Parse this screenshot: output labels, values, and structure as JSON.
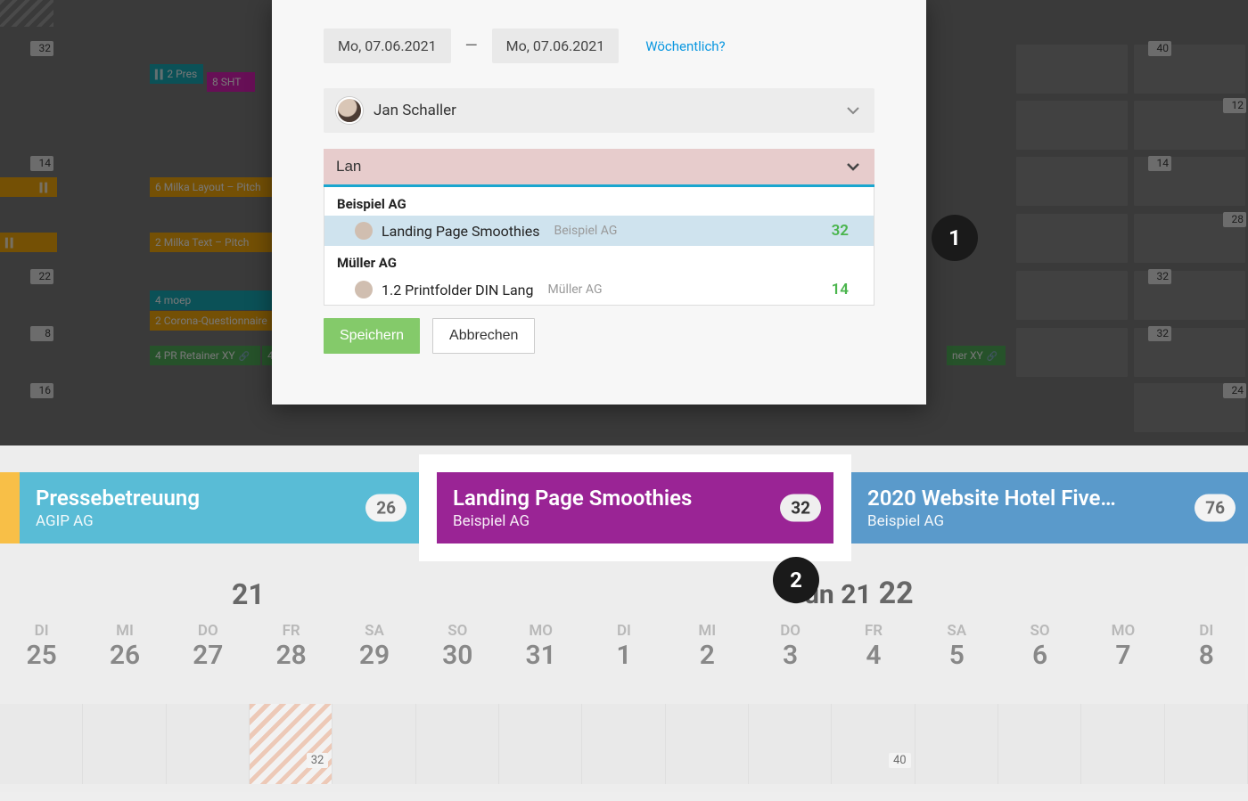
{
  "top_bg": {
    "left_badges": [
      "32",
      "14",
      "22",
      "8",
      "16"
    ],
    "right_badges": [
      "40",
      "12",
      "14",
      "28",
      "32",
      "32",
      "24"
    ],
    "chips": {
      "teal_pres": "2  Pres",
      "pink_sht": "8  SHT",
      "milka_layout": "6  Milka Layout – Pitch",
      "milka_text": "2  Milka Text – Pitch",
      "moep": "4  moep",
      "corona": "2  Corona-Questionnaire",
      "pr_left": "4  PR Retainer XY",
      "pr_mini": "4",
      "pr_right": "ner XY"
    }
  },
  "modal": {
    "date_from": "Mo, 07.06.2021",
    "date_to": "Mo, 07.06.2021",
    "weekly": "Wöchentlich?",
    "person": "Jan Schaller",
    "search_value": "Lan",
    "groups": [
      {
        "name": "Beispiel AG",
        "items": [
          {
            "title": "Landing Page Smoothies",
            "sub": "Beispiel AG",
            "num": "32",
            "hovered": true
          }
        ]
      },
      {
        "name": "Müller AG",
        "items": [
          {
            "title": "1.2 Printfolder DIN Lang",
            "sub": "Müller AG",
            "num": "14",
            "hovered": false
          }
        ]
      }
    ],
    "save": "Speichern",
    "cancel": "Abbrechen"
  },
  "markers": {
    "one": "1",
    "two": "2"
  },
  "projects": [
    {
      "title": "Pressebetreuung",
      "sub": "AGIP AG",
      "num": "26",
      "cls": "pc-teal"
    },
    {
      "title": "Landing Page Smoothies",
      "sub": "Beispiel AG",
      "num": "32",
      "cls": "pc-purple"
    },
    {
      "title": "2020 Website Hotel Five…",
      "sub": "Beispiel AG",
      "num": "76",
      "cls": "pc-blue"
    }
  ],
  "timeline": {
    "weeks": [
      {
        "txt": "21",
        "current": false
      },
      {
        "txt": "22",
        "current": true,
        "month": "Jun 21"
      }
    ],
    "days": [
      {
        "abbr": "DI",
        "num": "25"
      },
      {
        "abbr": "MI",
        "num": "26"
      },
      {
        "abbr": "DO",
        "num": "27"
      },
      {
        "abbr": "FR",
        "num": "28"
      },
      {
        "abbr": "SA",
        "num": "29"
      },
      {
        "abbr": "SO",
        "num": "30"
      },
      {
        "abbr": "MO",
        "num": "31"
      },
      {
        "abbr": "DI",
        "num": "1"
      },
      {
        "abbr": "MI",
        "num": "2"
      },
      {
        "abbr": "DO",
        "num": "3"
      },
      {
        "abbr": "FR",
        "num": "4"
      },
      {
        "abbr": "SA",
        "num": "5"
      },
      {
        "abbr": "SO",
        "num": "6"
      },
      {
        "abbr": "MO",
        "num": "7"
      },
      {
        "abbr": "DI",
        "num": "8"
      }
    ],
    "mini_badges": {
      "b32": "32",
      "b40": "40"
    }
  }
}
